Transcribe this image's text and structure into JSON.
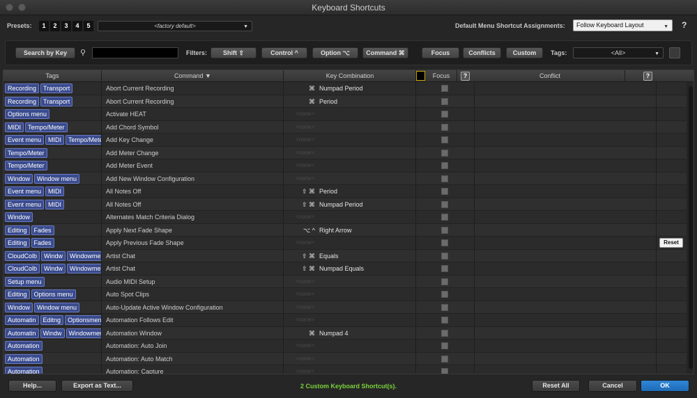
{
  "window": {
    "title": "Keyboard Shortcuts"
  },
  "presets": {
    "label": "Presets:",
    "numbers": [
      "1",
      "2",
      "3",
      "4",
      "5"
    ],
    "value": "<factory default>"
  },
  "menu_assign": {
    "label": "Default Menu Shortcut Assignments:",
    "value": "Follow Keyboard Layout",
    "help": "?"
  },
  "filters": {
    "search_by_key": "Search by Key",
    "search_value": "",
    "label": "Filters:",
    "shift": "Shift ⇧",
    "control": "Control ^",
    "option": "Option ⌥",
    "command": "Command ⌘",
    "focus": "Focus",
    "conflicts": "Conflicts",
    "custom": "Custom",
    "tags_label": "Tags:",
    "tags_value": "<All>"
  },
  "columns": {
    "tags": "Tags",
    "command": "Command ▼",
    "key_combination": "Key Combination",
    "focus": "Focus",
    "conflict": "Conflict",
    "help": "?"
  },
  "none_text": "<none>",
  "rows": [
    {
      "tags": [
        "Recording",
        "Transport"
      ],
      "command": "Abort Current Recording",
      "mods": "⌘",
      "key": "Numpad Period"
    },
    {
      "tags": [
        "Recording",
        "Transport"
      ],
      "command": "Abort Current Recording",
      "mods": "⌘",
      "key": "Period"
    },
    {
      "tags": [
        "Options menu"
      ],
      "command": "Activate HEAT",
      "mods": "",
      "key": ""
    },
    {
      "tags": [
        "MIDI",
        "Tempo/Meter"
      ],
      "command": "Add Chord Symbol",
      "mods": "",
      "key": ""
    },
    {
      "tags": [
        "Event menu",
        "MIDI",
        "Tempo/Meter"
      ],
      "command": "Add Key Change",
      "mods": "",
      "key": ""
    },
    {
      "tags": [
        "Tempo/Meter"
      ],
      "command": "Add Meter Change",
      "mods": "",
      "key": ""
    },
    {
      "tags": [
        "Tempo/Meter"
      ],
      "command": "Add Meter Event",
      "mods": "",
      "key": ""
    },
    {
      "tags": [
        "Window",
        "Window menu"
      ],
      "command": "Add New Window Configuration",
      "mods": "",
      "key": ""
    },
    {
      "tags": [
        "Event menu",
        "MIDI"
      ],
      "command": "All Notes Off",
      "mods": "⇧ ⌘",
      "key": "Period"
    },
    {
      "tags": [
        "Event menu",
        "MIDI"
      ],
      "command": "All Notes Off",
      "mods": "⇧ ⌘",
      "key": "Numpad Period"
    },
    {
      "tags": [
        "Window"
      ],
      "command": "Alternates Match Criteria Dialog",
      "mods": "",
      "key": ""
    },
    {
      "tags": [
        "Editing",
        "Fades"
      ],
      "command": "Apply Next Fade Shape",
      "mods": "⌥ ^",
      "key": "Right Arrow"
    },
    {
      "tags": [
        "Editing",
        "Fades"
      ],
      "command": "Apply Previous Fade Shape",
      "mods": "",
      "key": "",
      "reset": "Reset"
    },
    {
      "tags": [
        "CloudColb",
        "Windw",
        "Windowmenu"
      ],
      "command": "Artist Chat",
      "mods": "⇧ ⌘",
      "key": "Equals"
    },
    {
      "tags": [
        "CloudColb",
        "Windw",
        "Windowmenu"
      ],
      "command": "Artist Chat",
      "mods": "⇧ ⌘",
      "key": "Numpad Equals"
    },
    {
      "tags": [
        "Setup menu"
      ],
      "command": "Audio MIDI Setup",
      "mods": "",
      "key": ""
    },
    {
      "tags": [
        "Editing",
        "Options menu"
      ],
      "command": "Auto Spot Clips",
      "mods": "",
      "key": ""
    },
    {
      "tags": [
        "Window",
        "Window menu"
      ],
      "command": "Auto-Update Active Window Configuration",
      "mods": "",
      "key": ""
    },
    {
      "tags": [
        "Automatin",
        "Editng",
        "Optionsmenu"
      ],
      "command": "Automation Follows Edit",
      "mods": "",
      "key": ""
    },
    {
      "tags": [
        "Automatin",
        "Windw",
        "Windowmenu"
      ],
      "command": "Automation Window",
      "mods": "⌘",
      "key": "Numpad 4"
    },
    {
      "tags": [
        "Automation"
      ],
      "command": "Automation: Auto Join",
      "mods": "",
      "key": ""
    },
    {
      "tags": [
        "Automation"
      ],
      "command": "Automation: Auto Match",
      "mods": "",
      "key": ""
    },
    {
      "tags": [
        "Automation"
      ],
      "command": "Automation: Capture",
      "mods": "",
      "key": ""
    }
  ],
  "bottom": {
    "help": "Help...",
    "export": "Export as Text...",
    "status": "2 Custom Keyboard Shortcut(s).",
    "reset_all": "Reset All",
    "cancel": "Cancel",
    "ok": "OK"
  }
}
